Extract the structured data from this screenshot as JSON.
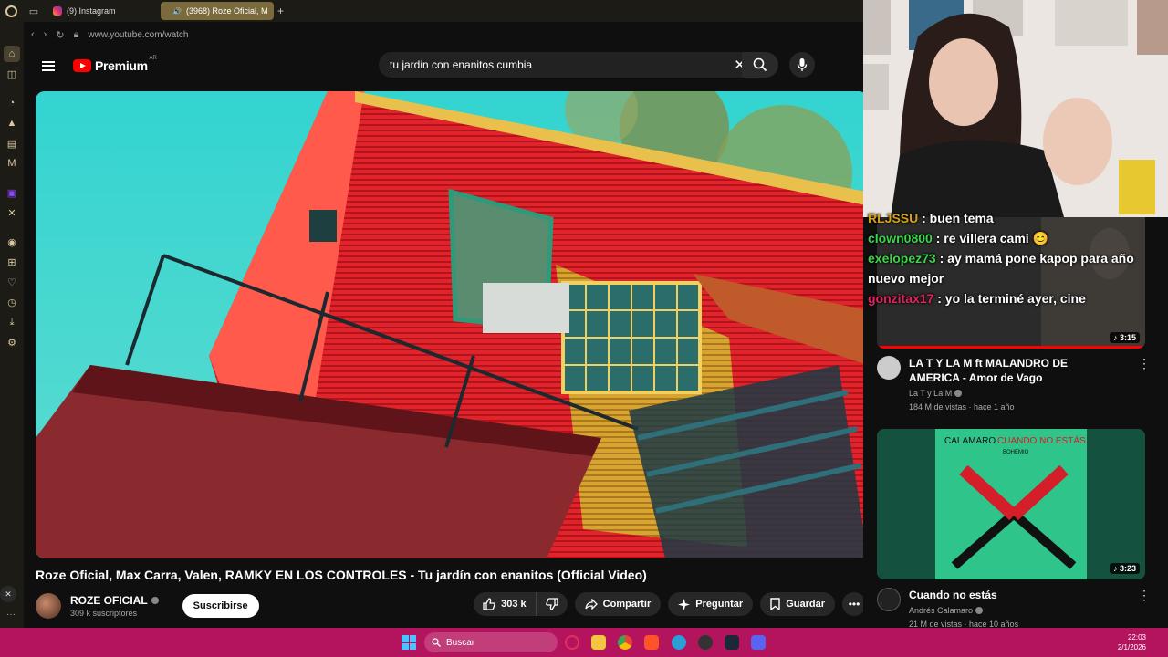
{
  "browser": {
    "tabs": [
      {
        "label": "(9) Instagram",
        "icon": "instagram-icon"
      },
      {
        "label": "(3968) Roze Oficial, M",
        "icon": "youtube-icon"
      }
    ],
    "url": "www.youtube.com/watch"
  },
  "youtube": {
    "logo_text": "Premium",
    "region": "AR",
    "search_query": "tu jardin con enanitos cumbia"
  },
  "video": {
    "title": "Roze Oficial, Max Carra, Valen, RAMKY EN LOS CONTROLES - Tu jardín con enanitos (Official Video)",
    "channel": "ROZE OFICIAL",
    "subscribers": "309 k suscriptores",
    "subscribe_label": "Suscribirse",
    "likes": "303 k",
    "share_label": "Compartir",
    "ask_label": "Preguntar",
    "save_label": "Guardar"
  },
  "chat": [
    {
      "user": "RLJSSU",
      "text": ": buen tema",
      "color": "#d4a017"
    },
    {
      "user": "clown0800",
      "text": ": re villera cami 😊",
      "color": "#3cd64a"
    },
    {
      "user": "exelopez73",
      "text": ": ay mamá pone kapop para año nuevo mejor",
      "color": "#3cd64a"
    },
    {
      "user": "gonzitax17",
      "text": ": yo la terminé ayer, cine",
      "color": "#e0245e"
    }
  ],
  "recommendations": [
    {
      "title": "LA T Y LA M ft MALANDRO DE AMERICA - Amor de Vago",
      "channel": "La T y La M",
      "stats": "184 M de vistas · hace 1 año",
      "duration": "3:15"
    },
    {
      "title": "Cuando no estás",
      "channel": "Andrés Calamaro",
      "stats": "21 M de vistas · hace 10 años",
      "duration": "3:23",
      "thumb_text_1": "CALAMARO",
      "thumb_text_2": "CUANDO NO ESTÁS",
      "thumb_text_3": "BOHEMIO"
    }
  ],
  "taskbar": {
    "search_label": "Buscar",
    "time": "22:03",
    "date": "2/1/2026"
  }
}
